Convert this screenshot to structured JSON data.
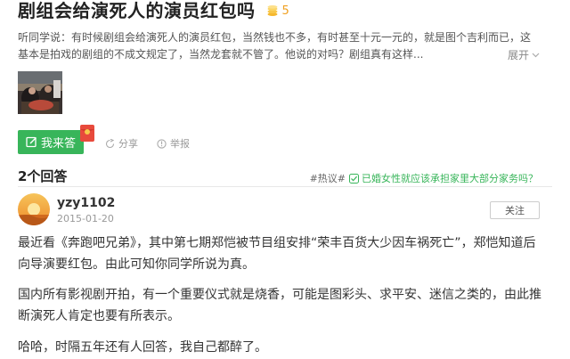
{
  "question": {
    "title": "剧组会给演死人的演员红包吗",
    "bounty": "5",
    "description": "听同学说：有时候剧组会给演死人的演员红包，当然钱也不多，有时甚至十元一元的，就是图个吉利而已，这基本是拍戏的剧组的不成文规定了，当然龙套就不管了。他说的对吗？剧组真有这样...",
    "expand_label": "展开"
  },
  "actions": {
    "answer_label": "我来答",
    "share_label": "分享",
    "report_label": "举报"
  },
  "answers_header": {
    "count_label": "2个回答",
    "hot_label": "#热议#",
    "hot_link": "已婚女性就应该承担家里大部分家务吗？"
  },
  "answer": {
    "username": "yzy1102",
    "date": "2015-01-20",
    "follow_label": "关注",
    "paragraphs": [
      "最近看《奔跑吧兄弟》，其中第七期郑恺被节目组安排“荣丰百货大少因车祸死亡”，郑恺知道后向导演要红包。由此可知你同学所说为真。",
      "国内所有影视剧开拍，有一个重要仪式就是烧香，可能是图彩头、求平安、迷信之类的，由此推断演死人肯定也要有所表示。",
      "哈哈，时隔五年还有人回答，我自己都醉了。"
    ]
  },
  "colors": {
    "accent_green": "#38b55a",
    "bounty_gold": "#f0a020"
  },
  "icons": [
    "coin-icon",
    "chevron-down-icon",
    "edit-icon",
    "red-envelope-icon",
    "share-icon",
    "report-icon",
    "check-icon"
  ]
}
